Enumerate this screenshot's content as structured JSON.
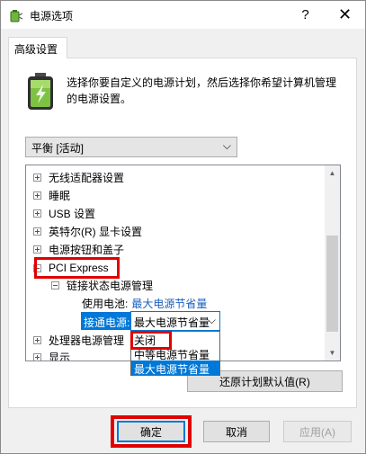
{
  "window": {
    "title": "电源选项",
    "help_glyph": "?",
    "close_glyph": "✕",
    "icon": "battery-icon"
  },
  "tab": {
    "label": "高级设置"
  },
  "description": "选择你要自定义的电源计划，然后选择你希望计算机管理的电源设置。",
  "plan_select": {
    "value": "平衡 [活动]"
  },
  "tree": {
    "items": [
      {
        "label": "无线适配器设置",
        "expander": "plus"
      },
      {
        "label": "睡眠",
        "expander": "plus"
      },
      {
        "label": "USB 设置",
        "expander": "plus"
      },
      {
        "label": "英特尔(R) 显卡设置",
        "expander": "plus"
      },
      {
        "label": "电源按钮和盖子",
        "expander": "plus"
      },
      {
        "label": "PCI Express",
        "expander": "minus"
      },
      {
        "label": "链接状态电源管理",
        "expander": "minus"
      },
      {
        "label": "处理器电源管理",
        "expander": "plus"
      },
      {
        "label": "显示",
        "expander": "plus"
      }
    ],
    "battery_label": "使用电池:",
    "battery_value": "最大电源节省量",
    "ac_label": "接通电源:",
    "ac_value": "最大电源节省量",
    "dropdown_options": [
      "关闭",
      "中等电源节省量",
      "最大电源节省量"
    ],
    "selected_option_index": 2
  },
  "buttons": {
    "restore": "还原计划默认值(R)",
    "ok": "确定",
    "cancel": "取消",
    "apply": "应用(A)"
  },
  "colors": {
    "accent": "#0078d7",
    "highlight_red": "#e00000",
    "link_blue": "#1a5fbf"
  }
}
